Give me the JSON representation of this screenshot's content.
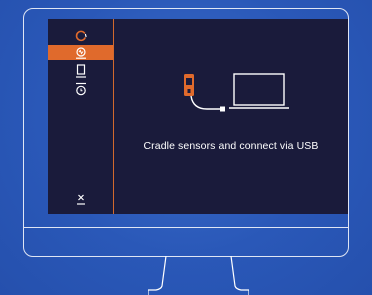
{
  "colors": {
    "background": "#2a58b8",
    "screen": "#1a1b3b",
    "accent": "#e06a2c",
    "frame": "#ffffff"
  },
  "sidebar": {
    "items": [
      {
        "icon": "loading-spinner-icon",
        "active": false
      },
      {
        "icon": "sensor-icon",
        "active": true
      },
      {
        "icon": "device-icon",
        "active": false
      },
      {
        "icon": "clock-icon",
        "active": false
      }
    ],
    "close_icon": "close-icon"
  },
  "main": {
    "caption": "Cradle sensors and connect via USB",
    "illustration": [
      "sensor-device-icon",
      "usb-cable-icon",
      "laptop-icon"
    ]
  }
}
